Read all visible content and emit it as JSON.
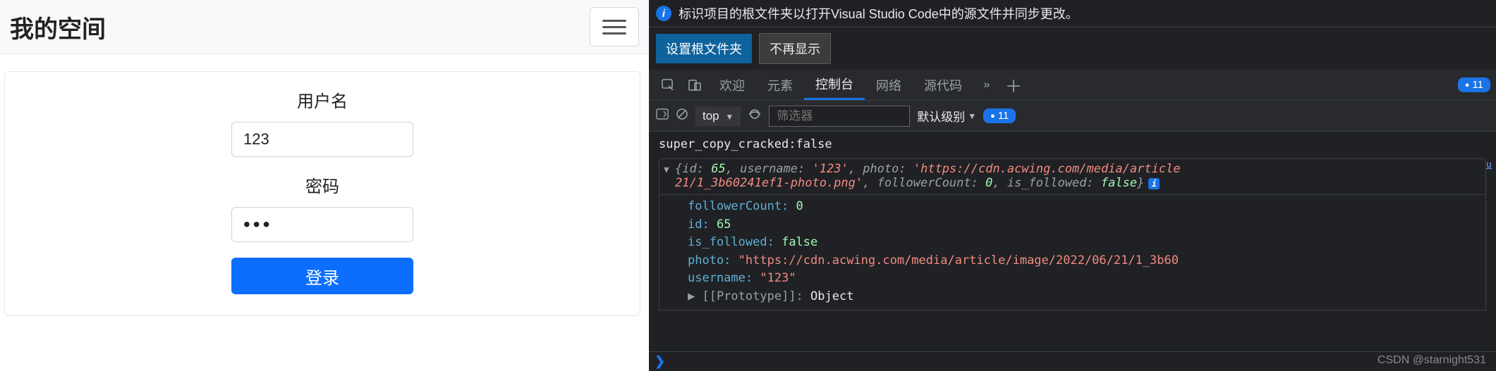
{
  "left": {
    "brand": "我的空间",
    "username_label": "用户名",
    "username_value": "123",
    "password_label": "密码",
    "password_value": "•••",
    "login_label": "登录"
  },
  "devtools": {
    "banner_text": "标识项目的根文件夹以打开Visual Studio Code中的源文件并同步更改。",
    "set_root": "设置根文件夹",
    "dismiss": "不再显示",
    "tabs": {
      "welcome": "欢迎",
      "elements": "元素",
      "console": "控制台",
      "network": "网络",
      "sources": "源代码"
    },
    "badge_count": "11",
    "toolbar": {
      "context": "top",
      "filter_placeholder": "筛选器",
      "level": "默认级别",
      "issues": "11"
    },
    "log1": "super_copy_cracked:false",
    "summary": {
      "open": "{id:",
      "id": "65",
      "c1": ", username:",
      "username": "'123'",
      "c2": ", photo:",
      "photo_line": "'https://cdn.acwing.com/media/article",
      "line2a": "21/1_3b60241ef1-photo.png'",
      "fc_key": ", followerCount:",
      "fc_val": "0",
      "isf_key": ", is_followed:",
      "isf_val": "false",
      "brace": "}"
    },
    "props": {
      "followerCount_k": "followerCount:",
      "followerCount_v": "0",
      "id_k": "id:",
      "id_v": "65",
      "is_followed_k": "is_followed:",
      "is_followed_v": "false",
      "photo_k": "photo:",
      "photo_v": "\"https://cdn.acwing.com/media/article/image/2022/06/21/1_3b60",
      "username_k": "username:",
      "username_v": "\"123\"",
      "proto_k": "[[Prototype]]:",
      "proto_v": "Object"
    },
    "watermark": "CSDN @starnight531"
  }
}
